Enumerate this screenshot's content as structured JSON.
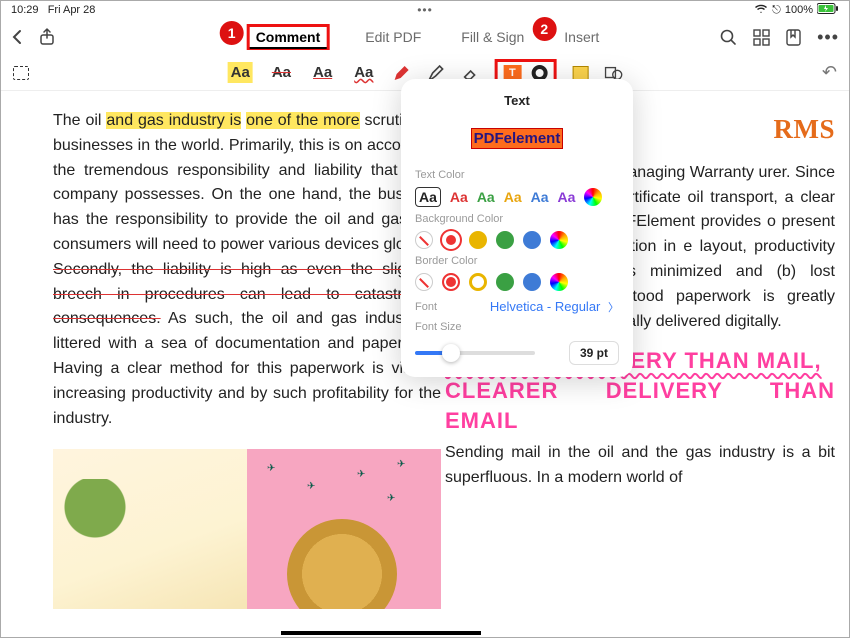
{
  "status": {
    "time": "10:29",
    "date": "Fri Apr 28",
    "bt": "100%"
  },
  "nav": {
    "comment": "Comment",
    "edit": "Edit PDF",
    "fillsign": "Fill & Sign",
    "insert": "Insert",
    "badge1": "1",
    "badge2": "2"
  },
  "toolbar": {
    "aa": "Aa",
    "t": "T"
  },
  "popup": {
    "title": "Text",
    "sample": "PDFelement",
    "text_color_label": "Text Color",
    "bg_color_label": "Background Color",
    "border_color_label": "Border Color",
    "font_label": "Font",
    "font_value": "Helvetica - Regular",
    "size_label": "Font Size",
    "size_value": "39 pt",
    "aa": "Aa",
    "text_colors": [
      "#222",
      "#d33",
      "#3aa043",
      "#e9a50e",
      "#3e7bd6",
      "#8a3bd6"
    ],
    "bg_colors": [
      "#e33",
      "#e9b500",
      "#3aa043",
      "#3e7bd6"
    ],
    "border_colors": [
      "#e33",
      "#e9b500",
      "#3aa043",
      "#3e7bd6"
    ]
  },
  "doc": {
    "left_pre": "The oil ",
    "left_hl1": "and gas industry is",
    "left_mid1": " ",
    "left_hl2": "one of the more",
    "left_p1b": " scrutinized businesses in the world. Primarily, this is on account of the tremendous responsibility and liability that each company possesses. On the one hand, the business has the responsibility to provide the oil and gas that consumers will need to power various devices globally. ",
    "left_strk": "Secondly, the liability is high as even the slightest breech in procedures can lead to catastrophic consequences.",
    "left_p1c": " As such, the oil and gas industry is littered with a sea of documentation and paperwork. Having a clear method for this paperwork is vital to increasing productivity and by such profitability for the industry.",
    "right_h1": "RMS",
    "right_p1": "y a back and forth of S (Managing Warranty urer. Since the MWS ive a COA (Certificate oil transport, a clear ology for presenting . PDFElement provides o present information g the information in e layout, productivity need to re-do tasks is minimized and (b) lost paperwork or misunderstood paperwork is greatly reduced as PDFs as typically delivered digitally.",
    "right_h2a": "QUICKER DELIVERY THAN MAIL,",
    "right_h2b": "CLEARER DELIVERY THAN EMAIL",
    "right_p2": "Sending mail in the oil and the gas industry is a bit superfluous. In a modern world of"
  }
}
